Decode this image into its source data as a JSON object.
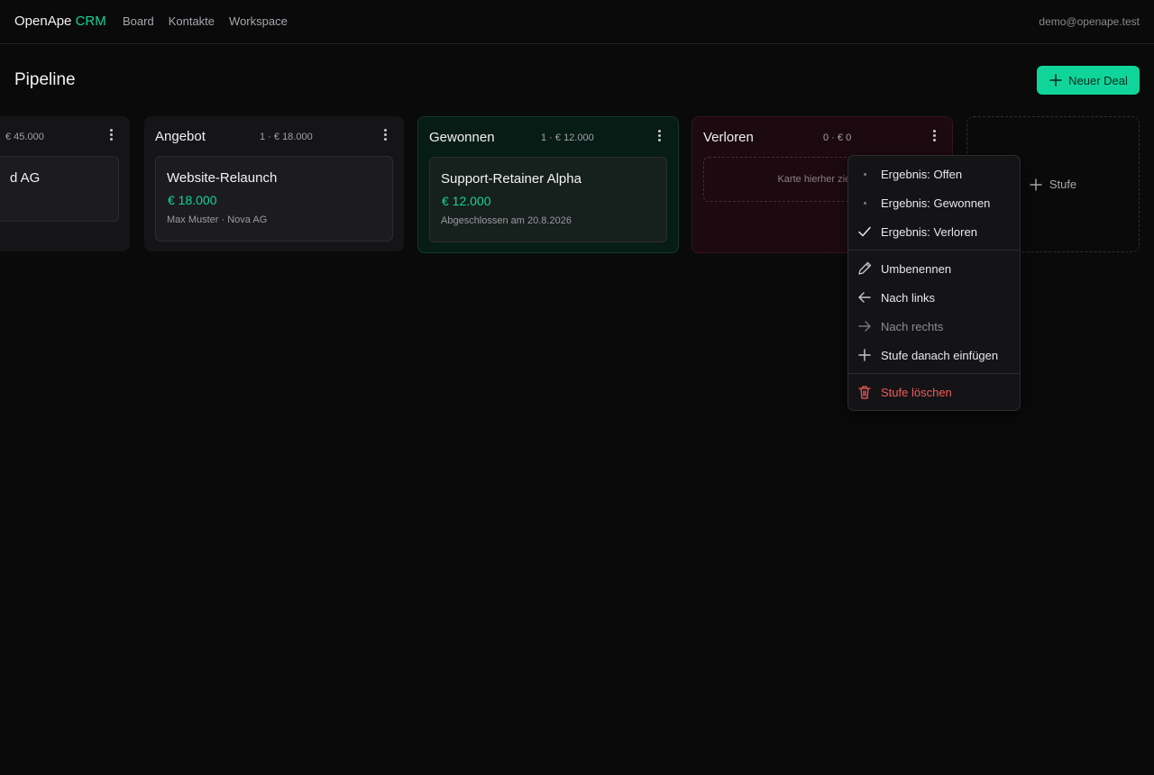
{
  "app": {
    "brand_main": "OpenApe",
    "brand_accent": "CRM",
    "user": "demo@openape.test"
  },
  "nav": [
    "Board",
    "Kontakte",
    "Workspace"
  ],
  "page": {
    "title": "Pipeline",
    "new_deal": "Neuer Deal"
  },
  "columns": [
    {
      "name": "",
      "meta": "€ 45.000",
      "card": {
        "title": "d AG",
        "amount": "",
        "sub": ""
      }
    },
    {
      "name": "Angebot",
      "meta": "1 · € 18.000",
      "card": {
        "title": "Website-Relaunch",
        "amount": "€ 18.000",
        "sub": "Max Muster · Nova AG"
      }
    },
    {
      "name": "Gewonnen",
      "meta": "1 · € 12.000",
      "card": {
        "title": "Support-Retainer Alpha",
        "amount": "€ 12.000",
        "sub": "Abgeschlossen am 20.8.2026"
      }
    },
    {
      "name": "Verloren",
      "meta": "0 · € 0",
      "dropzone": "Karte hierher ziehen"
    }
  ],
  "add_stage": "Stufe",
  "menu": {
    "outcome_open": "Ergebnis: Offen",
    "outcome_won": "Ergebnis: Gewonnen",
    "outcome_lost": "Ergebnis: Verloren",
    "rename": "Umbenennen",
    "move_left": "Nach links",
    "move_right": "Nach rechts",
    "insert_after": "Stufe danach einfügen",
    "delete": "Stufe löschen"
  },
  "colors": {
    "accent": "#10d59a",
    "background": "#0a0a0b",
    "danger": "#ef5b5b"
  }
}
